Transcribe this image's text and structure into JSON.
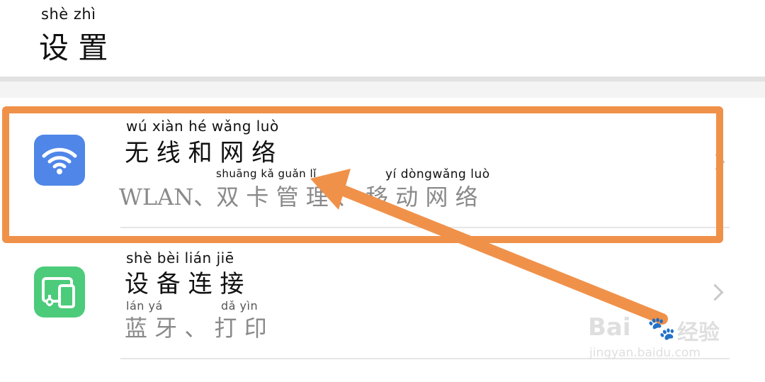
{
  "header": {
    "title_pinyin": "shè  zhì",
    "title": "设 置"
  },
  "items": [
    {
      "title_pinyin": "wú  xiàn  hé  wǎng luò",
      "title": "无 线 和 网 络",
      "subtitle_pinyin_1": "shuāng  kǎ  guǎn  lǐ",
      "subtitle_pinyin_2": "yí  dòngwǎng luò",
      "subtitle": "WLAN、双 卡 管 理 、 移 动 网 络",
      "icon": "wifi-icon",
      "icon_color": "#4f86e8"
    },
    {
      "title_pinyin": "shè  bèi  lián  jiē",
      "title": "设 备 连 接",
      "subtitle_pinyin_1": "lán   yá",
      "subtitle_pinyin_2": "dǎ   yìn",
      "subtitle": "蓝 牙 、 打 印",
      "icon": "device-connection-icon",
      "icon_color": "#4ccb7a"
    }
  ],
  "annotation": {
    "highlight_color": "#f0914a",
    "arrow_color": "#f0914a"
  },
  "watermark": {
    "brand": "Bai",
    "brand_tail": "经验",
    "url": "jingyan.baidu.com"
  }
}
